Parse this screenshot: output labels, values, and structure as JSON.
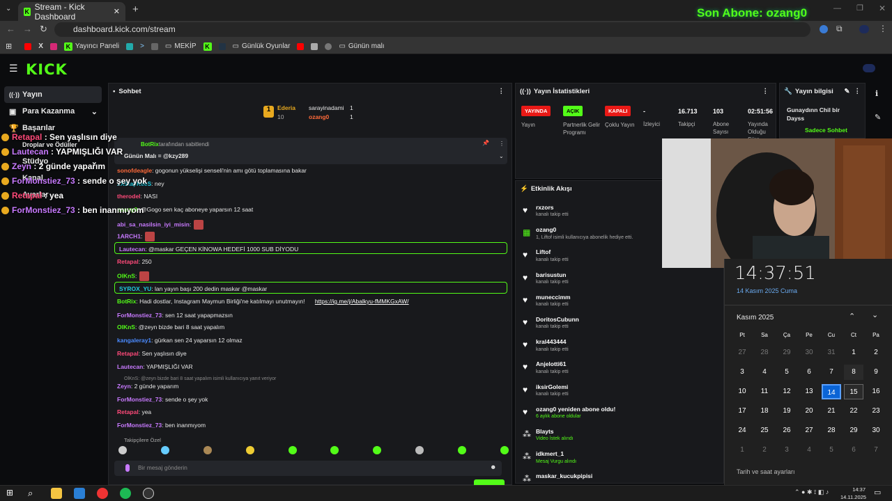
{
  "browser": {
    "tab_title": "Stream - Kick Dashboard",
    "url": "dashboard.kick.com/stream",
    "bookmarks": [
      "Yayıncı Paneli",
      "MEKİP",
      "Günlük Oyunlar",
      "Günün malı"
    ]
  },
  "overlay_top": "Son Abone: ozang0",
  "kick": {
    "logo": "KICK",
    "sidebar": [
      "Yayın",
      "Para Kazanma",
      "Başarılar",
      "Droplar ve Ödüller",
      "Stüdyo",
      "Kanal",
      "Ayarlar"
    ]
  },
  "overlay_chat": [
    {
      "user": "Retapal",
      "text": " : Sen yaşlısın diye",
      "color": "#ff4a7a"
    },
    {
      "user": "Lautecan",
      "text": " : YAPMIŞLIĞI VAR",
      "color": "#c87aff"
    },
    {
      "user": "Zeyn",
      "text": " : 2 günde yaparım",
      "color": "#c87aff"
    },
    {
      "user": "ForMonstiez_73",
      "text": " : sende o şey yok",
      "color": "#c87aff"
    },
    {
      "user": "Retapal",
      "text": " : yea",
      "color": "#ff4a7a"
    },
    {
      "user": "ForMonstiez_73",
      "text": " : ben inanmıyom",
      "color": "#c87aff"
    }
  ],
  "chat": {
    "title": "Sohbet",
    "top_gifters": [
      {
        "name": "Ederia",
        "count": "10"
      },
      {
        "name": "sarayinadami",
        "count": "1"
      },
      {
        "name": "ozang0",
        "count": "1"
      }
    ],
    "pinned_by": "BotRix",
    "pinned_note": "tarafından sabitlendi",
    "pinned_text": "Günün Malı = @kzy289",
    "messages": [
      {
        "user": "sonofdeagle",
        "text": ": gogonun yükselişi senseli'nin amı götü toplamasına bakar",
        "color": "#ff6a3a"
      },
      {
        "user": "xXSlayKeeS",
        "text": ": ney",
        "color": "#1ecbe1"
      },
      {
        "user": "therodel",
        "text": ": NASI",
        "color": "#ff4a7a"
      },
      {
        "user": "ozang0",
        "text": ": @Gogo sen kaç aboneye yaparsın 12 saat",
        "color": "#53fc18"
      },
      {
        "user": "abi_sa_nasilsin_iyi_misin",
        "text": ":",
        "color": "#c87aff"
      },
      {
        "user": "1ARCH1",
        "text": ":",
        "color": "#c87aff"
      },
      {
        "user": "Lautecan",
        "text": ": @maskar GEÇEN KİNOWA HEDEFİ 1000 SUB DİYODU",
        "color": "#c87aff"
      },
      {
        "user": "Retapal",
        "text": ": 250",
        "color": "#ff4a7a"
      },
      {
        "user": "OlKnS",
        "text": ":",
        "color": "#53fc18"
      },
      {
        "user": "SYROX_YU",
        "text": ": lan yayın başı 200 dedin maskar @maskar",
        "color": "#1ecbe1"
      },
      {
        "user": "BotRix",
        "text": ": Hadi dostlar, Instagram Maymun Birliği'ne katılmayı unutmayın! ",
        "color": "#53fc18"
      },
      {
        "user": "ForMonstiez_73",
        "text": ": sen 12 saat yapapmazsın",
        "color": "#c87aff"
      },
      {
        "user": "OlKnS",
        "text": ": @zeyn bizde bari 8 saat yapalım",
        "color": "#53fc18"
      },
      {
        "user": "kangaleray1",
        "text": ": gürkan sen 24 yaparsın 12 olmaz",
        "color": "#4a8aff"
      },
      {
        "user": "Retapal",
        "text": ": Sen yaşlısın diye",
        "color": "#ff4a7a"
      },
      {
        "user": "Lautecan",
        "text": ": YAPMIŞLIĞI VAR",
        "color": "#c87aff"
      },
      {
        "user": "Zeyn",
        "text": ": 2 günde yaparım",
        "color": "#c87aff"
      },
      {
        "user": "ForMonstiez_73",
        "text": ": sende o şey yok",
        "color": "#c87aff"
      },
      {
        "user": "Retapal",
        "text": ": yea",
        "color": "#ff4a7a"
      },
      {
        "user": "ForMonstiez_73",
        "text": ": ben inanmıyom",
        "color": "#c87aff"
      }
    ],
    "botrix_link": "https://ig.me/j/Abalkyu-fMMKGxAW/",
    "reply_note": "OlKnS: @zeyn bizde bari 8 saat yapalım isimli kullanıcıya yanıt veriyor",
    "followers_only": "Takipçilere Özel",
    "input_placeholder": "Bir mesaj gönderin"
  },
  "stats": {
    "title": "Yayın İstatistikleri",
    "items": [
      {
        "badge": "YAYINDA",
        "label": "Yayın",
        "color": "#e91916"
      },
      {
        "badge": "AÇIK",
        "label": "Partnerlik Gelir Programı",
        "color": "#53fc18"
      },
      {
        "badge": "KAPALI",
        "label": "Çoklu Yayın",
        "color": "#e91916"
      }
    ],
    "values": [
      {
        "value": "-",
        "label": "İzleyici"
      },
      {
        "value": "16.713",
        "label": "Takipçi"
      },
      {
        "value": "103",
        "label": "Abone Sayısı"
      },
      {
        "value": "02:51:56",
        "label": "Yayında Olduğu Süre"
      }
    ]
  },
  "info": {
    "title": "Yayın bilgisi",
    "stream_title": "Gunaydınn Chil bir Dayss",
    "mode": "Sadece Sohbet"
  },
  "events": {
    "title": "Etkinlik Akışı",
    "items": [
      {
        "name": "rxzors",
        "desc": "kanalı takip etti"
      },
      {
        "name": "ozang0",
        "desc": "1, Liftof isimli kullanıcıya abonelik hediye etti."
      },
      {
        "name": "Liftof",
        "desc": "kanalı takip etti"
      },
      {
        "name": "barisustun",
        "desc": "kanalı takip etti"
      },
      {
        "name": "muneccimm",
        "desc": "kanalı takip etti"
      },
      {
        "name": "DoritosCubunn",
        "desc": "kanalı takip etti"
      },
      {
        "name": "kral443444",
        "desc": "kanalı takip etti"
      },
      {
        "name": "Anjelotti61",
        "desc": "kanalı takip etti"
      },
      {
        "name": "iksirGolemi",
        "desc": "kanalı takip etti"
      },
      {
        "name": "ozang0 yeniden abone oldu!",
        "desc": "6 aylık abone oldular"
      },
      {
        "name": "Blayts",
        "desc": "Video İstek alındı"
      },
      {
        "name": "idkmert_1",
        "desc": "Mesaj Vurgu alındı"
      },
      {
        "name": "maskar_kucukpipisi",
        "desc": ""
      }
    ]
  },
  "calendar": {
    "time": "14:37:51",
    "date": "14 Kasım 2025 Cuma",
    "month": "Kasım 2025",
    "weekdays": [
      "Pt",
      "Sa",
      "Ça",
      "Pe",
      "Cu",
      "Ct",
      "Pa"
    ],
    "days": [
      "27",
      "28",
      "29",
      "30",
      "31",
      "1",
      "2",
      "3",
      "4",
      "5",
      "6",
      "7",
      "8",
      "9",
      "10",
      "11",
      "12",
      "13",
      "14",
      "15",
      "16",
      "17",
      "18",
      "19",
      "20",
      "21",
      "22",
      "23",
      "24",
      "25",
      "26",
      "27",
      "28",
      "29",
      "30",
      "1",
      "2",
      "3",
      "4",
      "5",
      "6",
      "7"
    ],
    "footer": "Tarih ve saat ayarları"
  },
  "taskbar": {
    "time": "14:37",
    "date": "14.11.2025"
  }
}
